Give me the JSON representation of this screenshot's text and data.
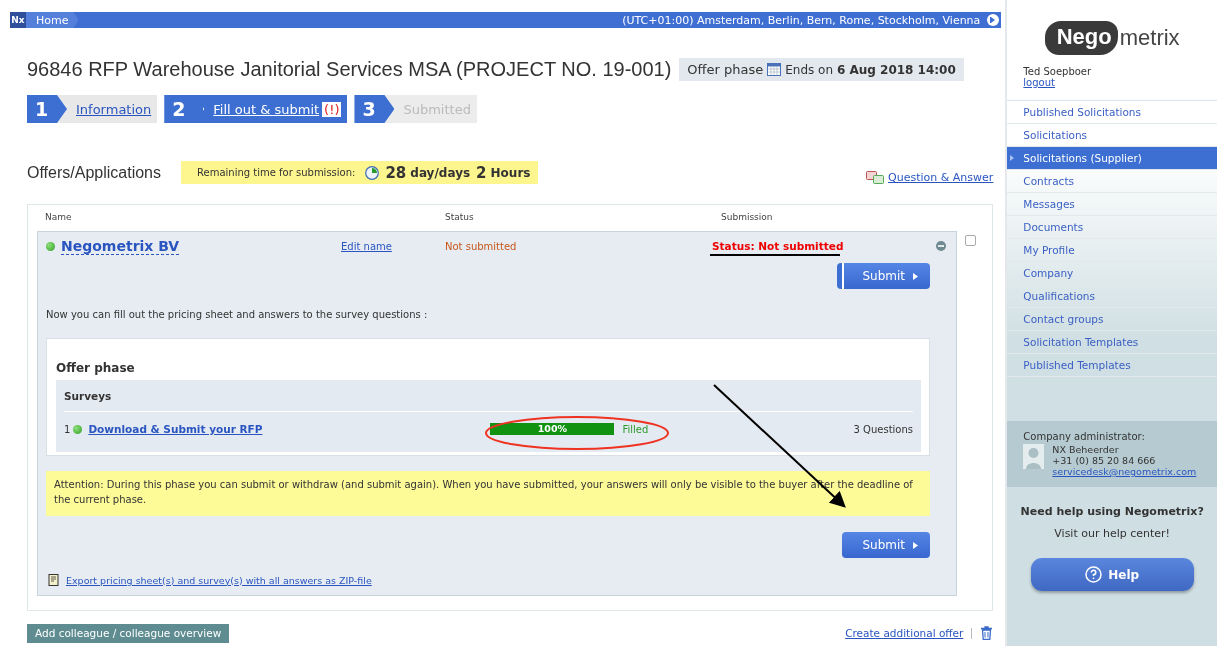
{
  "top_bar": {
    "logo": "Nx",
    "home": "Home",
    "timezone": "(UTC+01:00) Amsterdam, Berlin, Bern, Rome, Stockholm, Vienna"
  },
  "title": "96846 RFP Warehouse Janitorial Services MSA (PROJECT NO. 19-001)",
  "phase": {
    "label": "Offer phase",
    "ends_prefix": "Ends on",
    "ends": "6 Aug 2018 14:00"
  },
  "steps": [
    {
      "number": "1",
      "label": "Information",
      "selected": false,
      "disabled": false
    },
    {
      "number": "2",
      "label": "Fill out & submit",
      "badge": "(!)",
      "selected": true,
      "disabled": false
    },
    {
      "number": "3",
      "label": "Submitted",
      "selected": false,
      "disabled": true
    }
  ],
  "offers": {
    "heading": "Offers/Applications",
    "remaining": {
      "label": "Remaining time for submission:",
      "days": "28",
      "days_unit": "day/days",
      "hours": "2",
      "hours_unit": "Hours"
    },
    "qa_link": "Question & Answer",
    "columns": [
      "Name",
      "Status",
      "Submission"
    ],
    "offer": {
      "name": "Negometrix BV",
      "edit": "Edit name",
      "status": "Not submitted",
      "submission": "Status: Not submitted",
      "submit": "Submit",
      "checked": false,
      "intro": "Now you can fill out the pricing sheet and answers to the survey questions :",
      "phase_title": "Offer phase",
      "surveys_title": "Surveys",
      "surveys": [
        {
          "number": "1",
          "name": "Download & Submit your RFP",
          "level": 1,
          "progress": "100%",
          "state": "Filled",
          "questions": "3 Questions"
        }
      ],
      "attention": "Attention: During this phase you can submit or withdraw (and submit again). When you have submitted, your answers will only be visible to the buyer after the deadline of the current phase.",
      "submit_bottom": "Submit",
      "export": "Export pricing sheet(s) and survey(s) with all answers as ZIP-file"
    }
  },
  "add_colleague": "Add colleague / colleague overview",
  "create_offer": "Create additional offer",
  "sidebar": {
    "logo_a": "Nego",
    "logo_b": "metrix",
    "user": "Ted Soepboer",
    "logout": "logout",
    "items": [
      {
        "label": "Published Solicitations",
        "selected": false
      },
      {
        "label": "Solicitations",
        "selected": false
      },
      {
        "label": "Solicitations (Supplier)",
        "selected": true
      },
      {
        "label": "Contracts",
        "selected": false
      },
      {
        "label": "Messages",
        "selected": false
      },
      {
        "label": "Documents",
        "selected": false
      },
      {
        "label": "My Profile",
        "selected": false
      },
      {
        "label": "Company",
        "selected": false
      },
      {
        "label": "Qualifications",
        "selected": false
      },
      {
        "label": "Contact groups",
        "selected": false
      },
      {
        "label": "Solicitation Templates",
        "selected": false
      },
      {
        "label": "Published Templates",
        "selected": false
      }
    ],
    "admin": {
      "heading": "Company administrator:",
      "name": "NX Beheerder",
      "phone": "+31 (0) 85 20 84 666",
      "email": "servicedesk@negometrix.com"
    },
    "help_title": "Need help using Negometrix?",
    "help_text": "Visit our help center!",
    "help_button": "Help"
  }
}
